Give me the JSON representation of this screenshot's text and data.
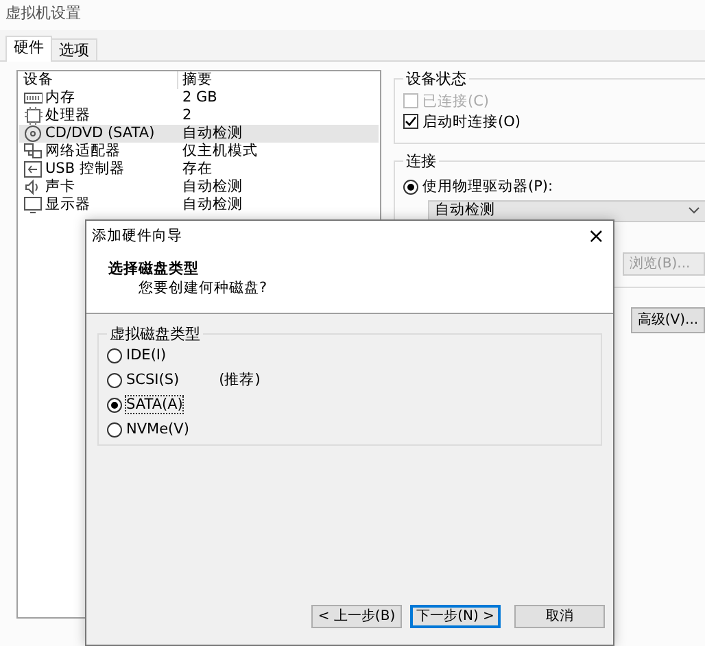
{
  "window": {
    "title": "虚拟机设置"
  },
  "tabs": [
    {
      "label": "硬件",
      "selected": true
    },
    {
      "label": "选项",
      "selected": false
    }
  ],
  "device_list": {
    "columns": [
      "设备",
      "摘要"
    ],
    "rows": [
      {
        "kind": "memory",
        "device": "内存",
        "summary": "2 GB",
        "selected": false
      },
      {
        "kind": "processor",
        "device": "处理器",
        "summary": "2",
        "selected": false
      },
      {
        "kind": "disc",
        "device": "CD/DVD (SATA)",
        "summary": "自动检测",
        "selected": true
      },
      {
        "kind": "network",
        "device": "网络适配器",
        "summary": "仅主机模式",
        "selected": false
      },
      {
        "kind": "usb",
        "device": "USB 控制器",
        "summary": "存在",
        "selected": false
      },
      {
        "kind": "sound",
        "device": "声卡",
        "summary": "自动检测",
        "selected": false
      },
      {
        "kind": "display",
        "device": "显示器",
        "summary": "自动检测",
        "selected": false
      }
    ]
  },
  "device_status": {
    "title": "设备状态",
    "checkboxes": [
      {
        "label": "已连接(C)",
        "checked": false,
        "disabled": true
      },
      {
        "label": "启动时连接(O)",
        "checked": true,
        "disabled": false
      }
    ]
  },
  "connection": {
    "title": "连接",
    "option": {
      "label": "使用物理驱动器(P):",
      "selected": true
    },
    "drive_select": {
      "value": "自动检测"
    },
    "browse_button": {
      "label": "浏览(B)...",
      "disabled": true
    }
  },
  "advanced_button": {
    "label": "高级(V)...",
    "disabled": false
  },
  "dialog": {
    "title": "添加硬件向导",
    "close": "×",
    "heading": "选择磁盘类型",
    "subheading": "您要创建何种磁盘?",
    "group_title": "虚拟磁盘类型",
    "options": [
      {
        "label": "IDE(I)",
        "selected": false
      },
      {
        "label": "SCSI(S)",
        "note": "(推荐)",
        "selected": false
      },
      {
        "label": "SATA(A)",
        "selected": true
      },
      {
        "label": "NVMe(V)",
        "selected": false
      }
    ],
    "buttons": [
      {
        "label": "< 上一步(B)",
        "default": false
      },
      {
        "label": "下一步(N) >",
        "default": true
      },
      {
        "label": "取消",
        "default": false
      }
    ]
  }
}
